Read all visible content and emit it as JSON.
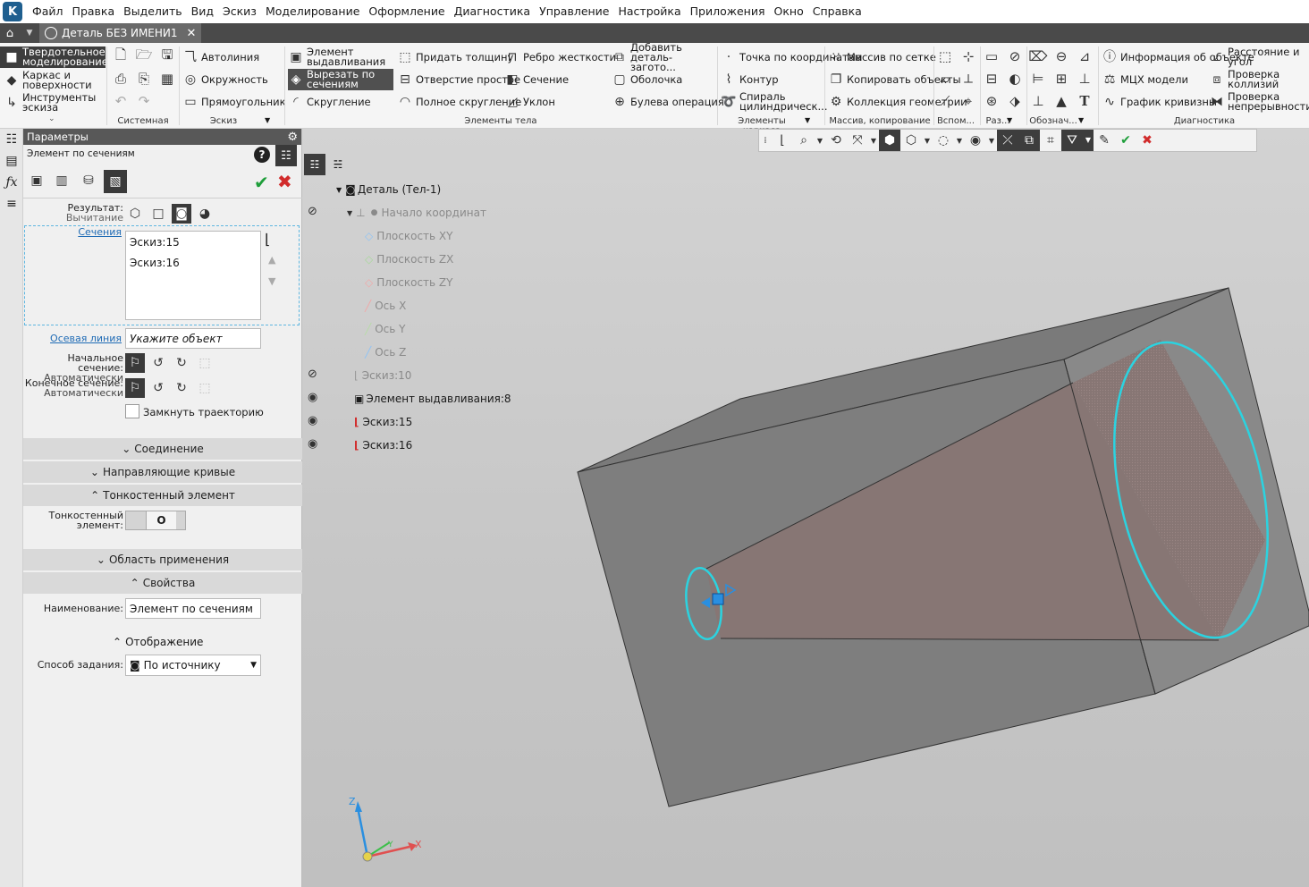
{
  "menu": [
    "Файл",
    "Правка",
    "Выделить",
    "Вид",
    "Эскиз",
    "Моделирование",
    "Оформление",
    "Диагностика",
    "Управление",
    "Настройка",
    "Приложения",
    "Окно",
    "Справка"
  ],
  "tab": {
    "title": "Деталь БЕЗ ИМЕНИ1",
    "close": "✕"
  },
  "ribbon": {
    "modes": [
      "Твердотельное моделирование",
      "Каркас и поверхности",
      "Инструменты эскиза"
    ],
    "sketch": [
      "Автолиния",
      "Окружность",
      "Прямоугольник"
    ],
    "body": [
      "Элемент выдавливания",
      "Вырезать по сечениям",
      "Скругление",
      "Придать толщину",
      "Отверстие простое",
      "Полное скругление",
      "Ребро жесткости",
      "Сечение",
      "Уклон",
      "Добавить деталь-загото...",
      "Оболочка",
      "Булева операция"
    ],
    "frame": [
      "Точка по координатам",
      "Контур",
      "Спираль цилиндрическ..."
    ],
    "array": [
      "Массив по сетке",
      "Копировать объекты",
      "Коллекция геометрии"
    ],
    "diag": [
      "Информация об объекте",
      "МЦХ модели",
      "График кривизны",
      "Расстояние и угол",
      "Проверка коллизий",
      "Проверка непрерывности"
    ],
    "groups": {
      "system": "Системная",
      "sketch": "Эскиз",
      "body": "Элементы тела",
      "frame": "Элементы каркаса",
      "array": "Массив, копирование",
      "aux": "Вспом...",
      "dims": "Раз...",
      "marks": "Обознач...",
      "diag": "Диагностика"
    }
  },
  "params": {
    "header": "Параметры",
    "subtitle": "Элемент по сечениям",
    "result_label": "Результат:",
    "result_value": "Вычитание",
    "sections_label": "Сечения",
    "sections": [
      "Эскиз:15",
      "Эскиз:16"
    ],
    "axis_label": "Осевая линия",
    "axis_placeholder": "Укажите объект",
    "start_label": "Начальное сечение:",
    "start_value": "Автоматически",
    "end_label": "Конечное сечение:",
    "end_value": "Автоматически",
    "close_traj": "Замкнуть траекторию",
    "sec_connection": "Соединение",
    "sec_guides": "Направляющие кривые",
    "sec_thin": "Тонкостенный элемент",
    "thin_label": "Тонкостенный элемент:",
    "sec_area": "Область применения",
    "sec_props": "Свойства",
    "name_label": "Наименование:",
    "name_value": "Элемент по сечениям",
    "display": "Отображение",
    "method_label": "Способ задания:",
    "method_value": "По источнику"
  },
  "tree": {
    "root": "Деталь (Тел-1)",
    "origin": "Начало координат",
    "items": [
      "Плоскость XY",
      "Плоскость ZX",
      "Плоскость ZY",
      "Ось X",
      "Ось Y",
      "Ось Z"
    ],
    "sketch10": "Эскиз:10",
    "extrude": "Элемент выдавливания:8",
    "sketch15": "Эскиз:15",
    "sketch16": "Эскиз:16"
  },
  "axes": {
    "x": "X",
    "y": "Y",
    "z": "Z"
  },
  "colors": {
    "accent": "#2bd3e0",
    "ok": "#1e9e3a",
    "cancel": "#d12b2b",
    "link": "#1f6bb5"
  }
}
